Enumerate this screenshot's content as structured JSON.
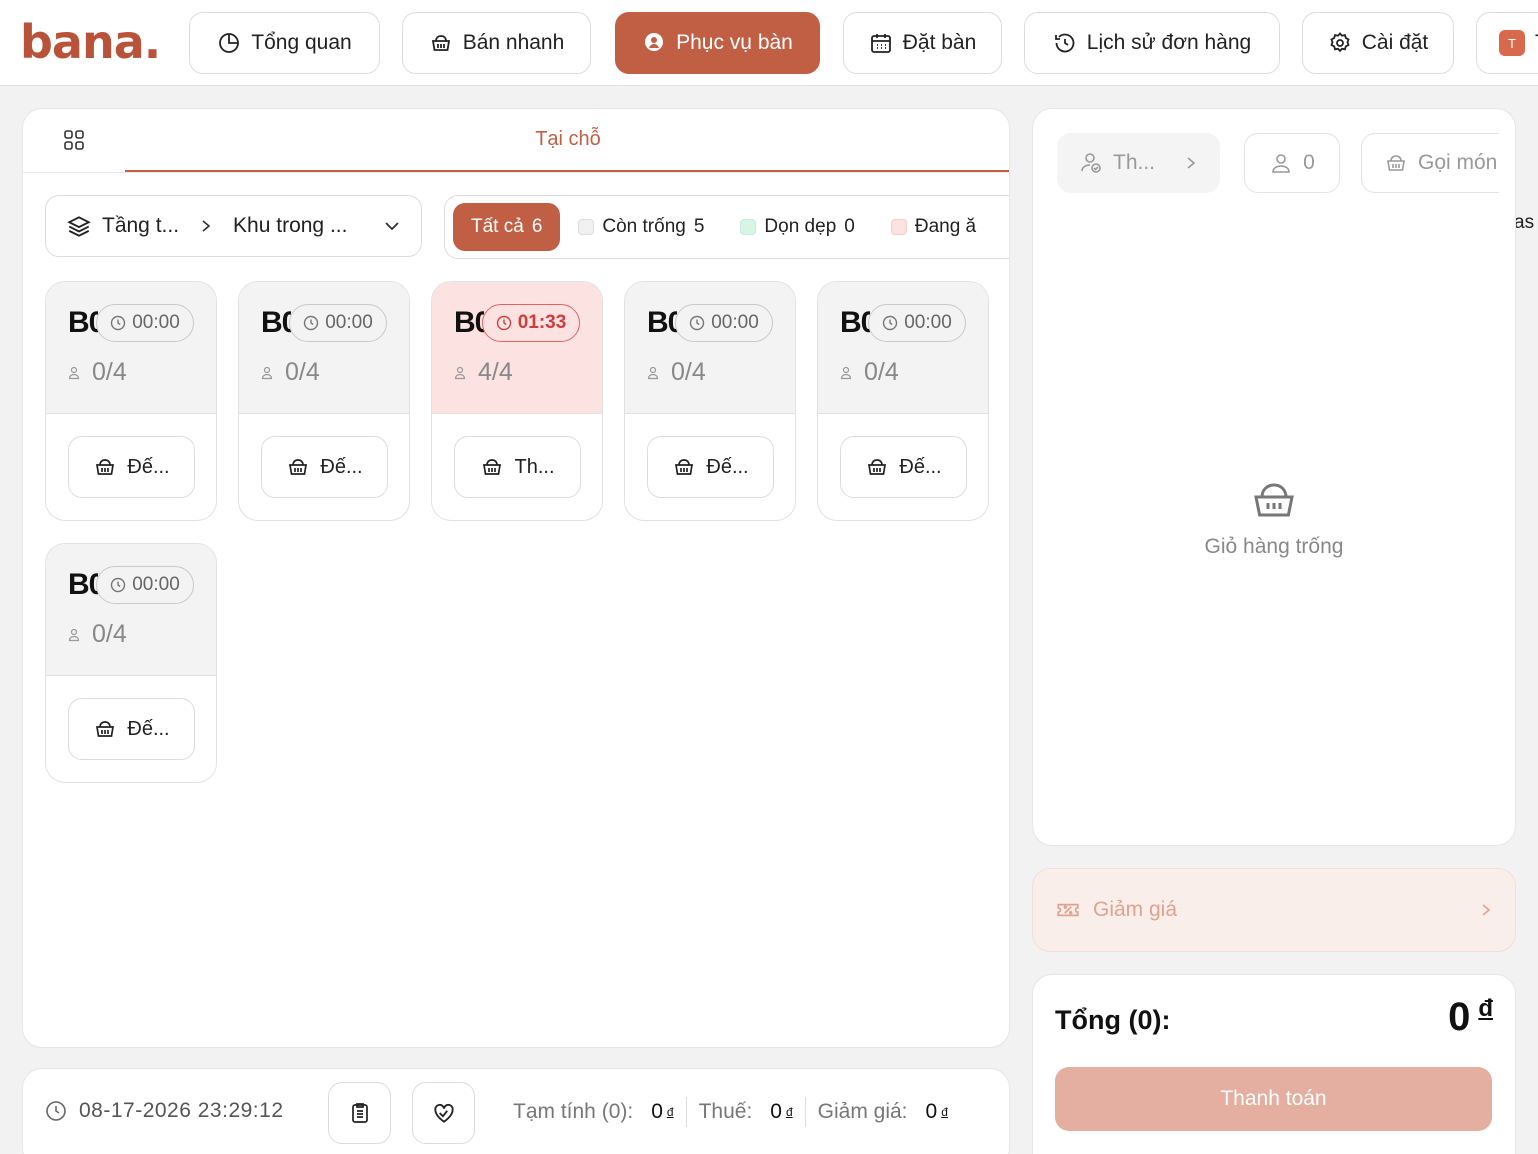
{
  "brand": {
    "logo_main": "bana",
    "logo_dot": "."
  },
  "nav": {
    "items": [
      {
        "label": "Tổng quan",
        "icon": "chart-pie-icon"
      },
      {
        "label": "Bán nhanh",
        "icon": "basket-icon"
      },
      {
        "label": "Phục vụ bàn",
        "icon": "waiter-icon",
        "active": true
      },
      {
        "label": "Đặt bàn",
        "icon": "calendar-icon"
      },
      {
        "label": "Lịch sử đơn hàng",
        "icon": "history-icon"
      },
      {
        "label": "Cài đặt",
        "icon": "gear-icon"
      }
    ],
    "user_initial": "T",
    "user_label": "T"
  },
  "tabs": {
    "active": "Tại chỗ"
  },
  "area": {
    "floor": "Tầng t...",
    "zone": "Khu trong ..."
  },
  "filters": [
    {
      "label": "Tất cả",
      "count": "6",
      "active": true
    },
    {
      "label": "Còn trống",
      "count": "5",
      "swatch": "#f1f1f1"
    },
    {
      "label": "Dọn dẹp",
      "count": "0",
      "swatch": "#d7f5e6"
    },
    {
      "label": "Đang ă",
      "count": "",
      "swatch": "#fde2e2"
    }
  ],
  "edge_text": "as",
  "tables": [
    {
      "name": "B0",
      "timer": "00:00",
      "guests": "0/4",
      "action": "Đế...",
      "busy": false
    },
    {
      "name": "B0",
      "timer": "00:00",
      "guests": "0/4",
      "action": "Đế...",
      "busy": false
    },
    {
      "name": "B0",
      "timer": "01:33",
      "guests": "4/4",
      "action": "Th...",
      "busy": true
    },
    {
      "name": "B0",
      "timer": "00:00",
      "guests": "0/4",
      "action": "Đế...",
      "busy": false
    },
    {
      "name": "B0",
      "timer": "00:00",
      "guests": "0/4",
      "action": "Đế...",
      "busy": false
    },
    {
      "name": "B0",
      "timer": "00:00",
      "guests": "0/4",
      "action": "Đế...",
      "busy": false
    }
  ],
  "status": {
    "datetime": "08-17-2026 23:29:12",
    "subtotal_label": "Tạm tính (0):",
    "subtotal_value": "0",
    "tax_label": "Thuế:",
    "tax_value": "0",
    "discount_label": "Giảm giá:",
    "discount_value": "0",
    "currency": "đ"
  },
  "cart": {
    "customer": "Th...",
    "guests": "0",
    "order": "Gọi món",
    "empty_text": "Giỏ hàng trống",
    "discount_label": "Giảm giá",
    "total_label": "Tổng (0):",
    "total_value": "0",
    "currency": "đ",
    "pay_label": "Thanh toán"
  },
  "colors": {
    "accent": "#c15f44",
    "busy": "#fde2e2",
    "pay_disabled": "#e4aea0"
  }
}
